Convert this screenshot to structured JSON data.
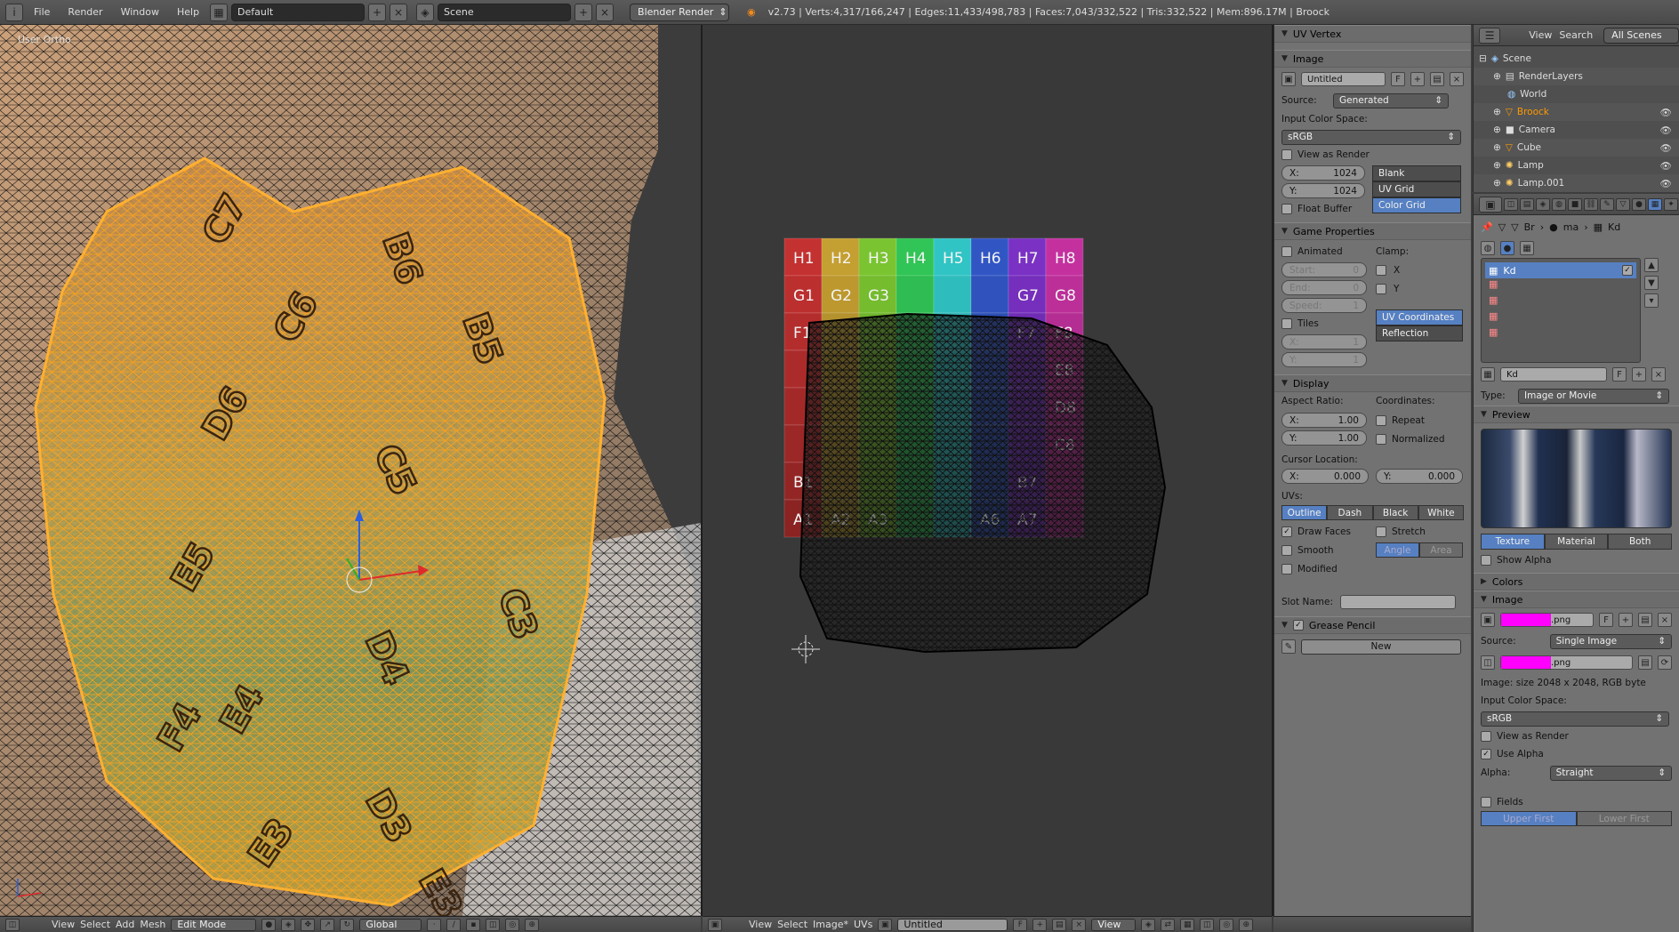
{
  "topbar": {
    "menus": [
      "File",
      "Render",
      "Window",
      "Help"
    ],
    "layout": "Default",
    "scene": "Scene",
    "engine": "Blender Render",
    "stats": "v2.73 | Verts:4,317/166,247 | Edges:11,433/498,783 | Faces:7,043/332,522 | Tris:332,522 | Mem:896.17M | Broock"
  },
  "view3d": {
    "label": "User Ortho",
    "bottom": {
      "menus": [
        "View",
        "Select",
        "Add",
        "Mesh"
      ],
      "mode": "Edit Mode",
      "orientation": "Global"
    }
  },
  "uv_editor": {
    "grid_rows": [
      "H",
      "G",
      "F",
      "E",
      "D",
      "C",
      "B",
      "A"
    ],
    "labels": [
      "H1",
      "H2",
      "H3",
      "H4",
      "H5",
      "H6",
      "H7",
      "H8",
      "G1",
      "G2",
      "G3",
      "G7",
      "G8",
      "F1",
      "F7",
      "F8",
      "E8",
      "D8",
      "C8",
      "B1",
      "B7",
      "A1",
      "A2",
      "A3",
      "A6",
      "A7"
    ],
    "bottom": {
      "menus": [
        "View",
        "Select",
        "Image*",
        "UVs"
      ],
      "image": "Untitled",
      "view": "View"
    }
  },
  "npanel": {
    "uv_vertex": "UV Vertex",
    "image": {
      "title": "Image",
      "name": "Untitled",
      "f": "F",
      "source_label": "Source:",
      "source": "Generated",
      "input_cs_label": "Input Color Space:",
      "input_cs": "sRGB",
      "view_as_render": "View as Render",
      "x_label": "X:",
      "x": "1024",
      "y_label": "Y:",
      "y": "1024",
      "float_buffer": "Float Buffer",
      "gen_types": [
        "Blank",
        "UV Grid",
        "Color Grid"
      ]
    },
    "game": {
      "title": "Game Properties",
      "animated": "Animated",
      "clamp": "Clamp:",
      "start_label": "Start:",
      "start": "0",
      "end_label": "End:",
      "end": "0",
      "speed_label": "Speed:",
      "speed": "1",
      "clamp_x": "X",
      "clamp_y": "Y",
      "tiles": "Tiles",
      "tx_label": "X:",
      "tx": "1",
      "ty_label": "Y:",
      "ty": "1",
      "mapping": [
        "UV Coordinates",
        "Reflection"
      ]
    },
    "display": {
      "title": "Display",
      "aspect": "Aspect Ratio:",
      "coords": "Coordinates:",
      "ax_label": "X:",
      "ax": "1.00",
      "ay_label": "Y:",
      "ay": "1.00",
      "repeat": "Repeat",
      "normalized": "Normalized",
      "cursor": "Cursor Location:",
      "cx_label": "X:",
      "cx": "0.000",
      "cy_label": "Y:",
      "cy": "0.000",
      "uvs": "UVs:",
      "uv_modes": [
        "Outline",
        "Dash",
        "Black",
        "White"
      ],
      "draw_faces": "Draw Faces",
      "stretch": "Stretch",
      "smooth": "Smooth",
      "angle": "Angle",
      "area": "Area",
      "modified": "Modified",
      "slot_name": "Slot Name:"
    },
    "grease": {
      "title": "Grease Pencil",
      "new": "New"
    }
  },
  "outliner": {
    "menus": [
      "View",
      "Search"
    ],
    "filter": "All Scenes",
    "items": [
      "Scene",
      "RenderLayers",
      "World",
      "Broock",
      "Camera",
      "Cube",
      "Lamp",
      "Lamp.001"
    ]
  },
  "props": {
    "context": [
      "Br",
      "ma",
      "Kd"
    ],
    "slots": [
      "Kd"
    ],
    "texture_name": "Kd",
    "type_label": "Type:",
    "type": "Image or Movie",
    "preview": "Preview",
    "tabs": [
      "Texture",
      "Material",
      "Both"
    ],
    "show_alpha": "Show Alpha",
    "colors": "Colors",
    "image": "Image",
    "img_name": ".png",
    "source_label": "Source:",
    "source": "Single Image",
    "file": ".png",
    "info": "Image: size 2048 x 2048, RGB byte",
    "input_cs_label": "Input Color Space:",
    "input_cs": "sRGB",
    "view_as_render": "View as Render",
    "use_alpha": "Use Alpha",
    "alpha_label": "Alpha:",
    "alpha": "Straight",
    "fields": "Fields",
    "field_order": [
      "Upper First",
      "Lower First"
    ]
  }
}
